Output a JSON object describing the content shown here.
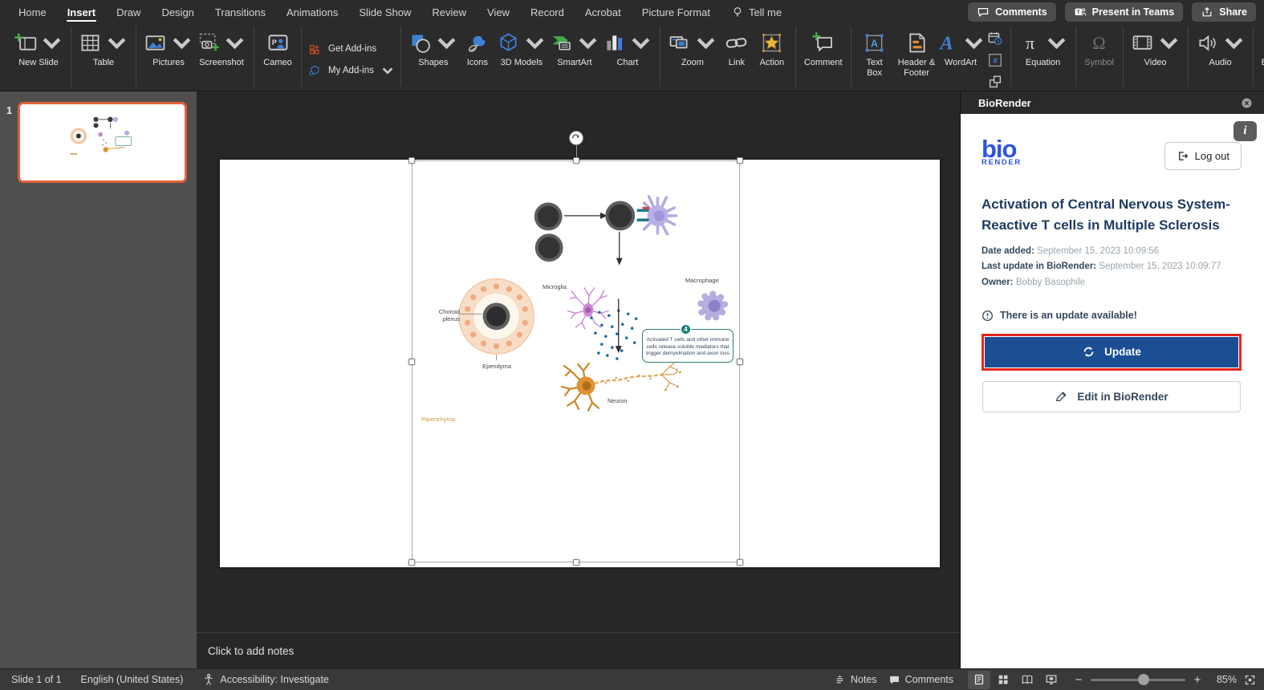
{
  "menu_bar": {
    "items": [
      {
        "label": "Home"
      },
      {
        "label": "Insert",
        "active": true
      },
      {
        "label": "Draw"
      },
      {
        "label": "Design"
      },
      {
        "label": "Transitions"
      },
      {
        "label": "Animations"
      },
      {
        "label": "Slide Show"
      },
      {
        "label": "Review"
      },
      {
        "label": "View"
      },
      {
        "label": "Record"
      },
      {
        "label": "Acrobat"
      },
      {
        "label": "Picture Format"
      },
      {
        "label": "Tell me",
        "icon": "lightbulb"
      }
    ],
    "right_buttons": [
      {
        "label": "Comments",
        "icon": "comment-bubble"
      },
      {
        "label": "Present in Teams",
        "icon": "teams"
      },
      {
        "label": "Share",
        "icon": "share"
      }
    ]
  },
  "ribbon": {
    "groups": [
      {
        "type": "normal",
        "items": [
          {
            "label": "New Slide",
            "icon": "new-slide",
            "chevron": true
          }
        ]
      },
      {
        "type": "normal",
        "items": [
          {
            "label": "Table",
            "icon": "table",
            "chevron": true
          }
        ]
      },
      {
        "type": "normal",
        "items": [
          {
            "label": "Pictures",
            "icon": "pictures",
            "chevron": true
          },
          {
            "label": "Screenshot",
            "icon": "screenshot",
            "chevron": true
          }
        ]
      },
      {
        "type": "normal",
        "items": [
          {
            "label": "Cameo",
            "icon": "cameo"
          }
        ]
      },
      {
        "type": "stack",
        "items": [
          {
            "label": "Get Add-ins",
            "icon": "get-addins"
          },
          {
            "label": "My Add-ins",
            "icon": "my-addins",
            "chevron": true
          }
        ]
      },
      {
        "type": "normal",
        "items": [
          {
            "label": "Shapes",
            "icon": "shapes",
            "chevron": true
          },
          {
            "label": "Icons",
            "icon": "icons"
          },
          {
            "label": "3D Models",
            "icon": "3d-models",
            "chevron": true
          },
          {
            "label": "SmartArt",
            "icon": "smartart",
            "chevron": true
          },
          {
            "label": "Chart",
            "icon": "chart",
            "chevron": true
          }
        ]
      },
      {
        "type": "normal",
        "items": [
          {
            "label": "Zoom",
            "icon": "zoom",
            "chevron": true
          },
          {
            "label": "Link",
            "icon": "link"
          },
          {
            "label": "Action",
            "icon": "action"
          }
        ]
      },
      {
        "type": "normal",
        "items": [
          {
            "label": "Comment",
            "icon": "comment"
          }
        ]
      },
      {
        "type": "normal",
        "items": [
          {
            "label": "Text Box",
            "icon": "text-box"
          },
          {
            "label": "Header & Footer",
            "icon": "header-footer"
          },
          {
            "label": "WordArt",
            "icon": "wordart",
            "chevron": true
          }
        ],
        "mini": [
          {
            "name": "date-and-time",
            "icon": "datetime"
          },
          {
            "name": "slide-number",
            "icon": "slidenumber"
          },
          {
            "name": "insert-object",
            "icon": "object"
          }
        ]
      },
      {
        "type": "normal",
        "items": [
          {
            "label": "Equation",
            "icon": "equation",
            "chevron": true
          }
        ]
      },
      {
        "type": "normal",
        "items": [
          {
            "label": "Symbol",
            "icon": "symbol",
            "disabled": true
          }
        ]
      },
      {
        "type": "normal",
        "items": [
          {
            "label": "Video",
            "icon": "video",
            "chevron": true
          }
        ]
      },
      {
        "type": "normal",
        "items": [
          {
            "label": "Audio",
            "icon": "audio",
            "chevron": true
          }
        ]
      },
      {
        "type": "normal",
        "items": [
          {
            "label": "BioRender",
            "icon": "biorender"
          }
        ]
      }
    ]
  },
  "thumbnails": {
    "number": "1"
  },
  "notes": {
    "placeholder": "Click to add notes"
  },
  "diagram": {
    "labels": {
      "choroid_plexus": "Choroid plexus",
      "ependyma": "Ependyma",
      "microglia": "Microglia",
      "macrophage": "Macrophage",
      "neuron": "Neuron",
      "parenchyma": "Parenchyma"
    },
    "annotation": {
      "badge": "4",
      "text": "Activated T cells and other immune cells release soluble mediators that trigger demyelination and axon loss"
    }
  },
  "panel": {
    "title": "BioRender",
    "logo": {
      "line1": "bio",
      "line2": "RENDER"
    },
    "logout_label": "Log out",
    "info_glyph": "i",
    "doc_title": "Activation of Central Nervous System-Reactive T cells in Multiple Sclerosis",
    "meta": [
      {
        "label": "Date added:",
        "value": "September 15, 2023 10:09:56"
      },
      {
        "label": "Last update in BioRender:",
        "value": "September 15, 2023 10:09:77"
      },
      {
        "label": "Owner:",
        "value": "Bobby Basophile"
      }
    ],
    "warning": "There is an update available!",
    "update_label": "Update",
    "edit_label": "Edit in BioRender"
  },
  "status": {
    "left": [
      {
        "label": "Slide 1 of 1"
      },
      {
        "label": "English (United States)"
      },
      {
        "label": "Accessibility: Investigate",
        "icon": "accessibility"
      }
    ],
    "notes_label": "Notes",
    "comments_label": "Comments",
    "zoom_value": "85%"
  },
  "colors": {
    "biorender_blue": "#2d55e0",
    "update_button_blue": "#1c4e94",
    "highlight_red": "#e8251f",
    "selected_thumbnail_orange": "#e0603c",
    "panel_text_navy": "#33475b"
  }
}
